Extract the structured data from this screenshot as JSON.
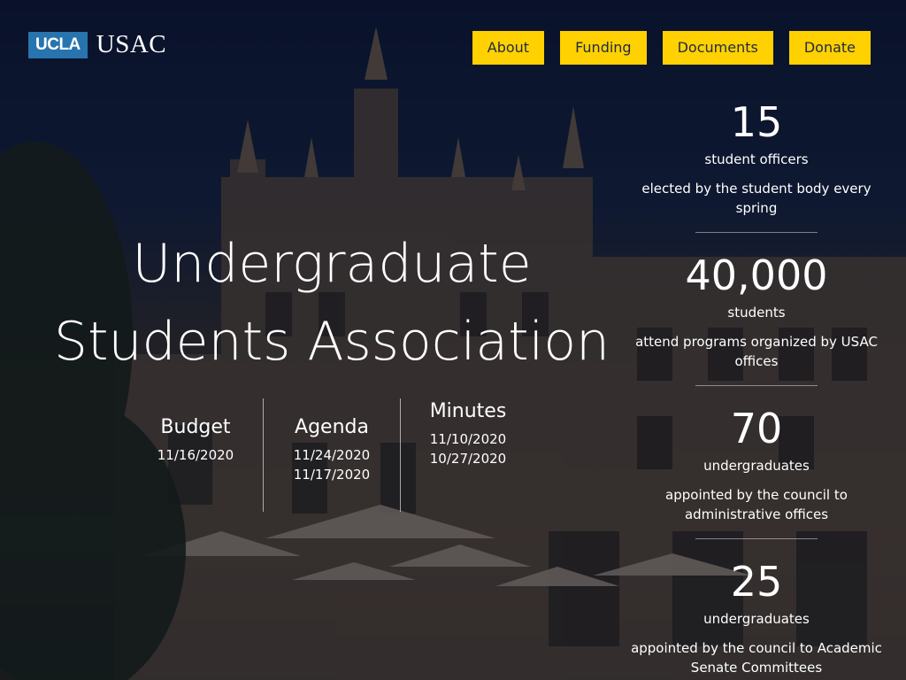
{
  "logo": {
    "badge": "UCLA",
    "name": "USAC"
  },
  "nav": [
    {
      "label": "About"
    },
    {
      "label": "Funding"
    },
    {
      "label": "Documents"
    },
    {
      "label": "Donate"
    }
  ],
  "hero": {
    "line1": "Undergraduate",
    "line2": "Students Association"
  },
  "documents": [
    {
      "title": "Budget",
      "dates": [
        "11/16/2020"
      ]
    },
    {
      "title": "Agenda",
      "dates": [
        "11/24/2020",
        "11/17/2020"
      ]
    },
    {
      "title": "Minutes",
      "dates": [
        "11/10/2020",
        "10/27/2020"
      ]
    }
  ],
  "stats": [
    {
      "number": "15",
      "label": "student officers",
      "desc": "elected by the student body every spring"
    },
    {
      "number": "40,000",
      "label": "students",
      "desc": "attend programs organized by USAC offices"
    },
    {
      "number": "70",
      "label": "undergraduates",
      "desc": "appointed by the council to administrative offices"
    },
    {
      "number": "25",
      "label": "undergraduates",
      "desc": "appointed by the council to Academic Senate Committees"
    }
  ],
  "colors": {
    "accent": "#ffd100",
    "nav_text": "#1f2a44",
    "ucla_blue": "#2774ae"
  }
}
